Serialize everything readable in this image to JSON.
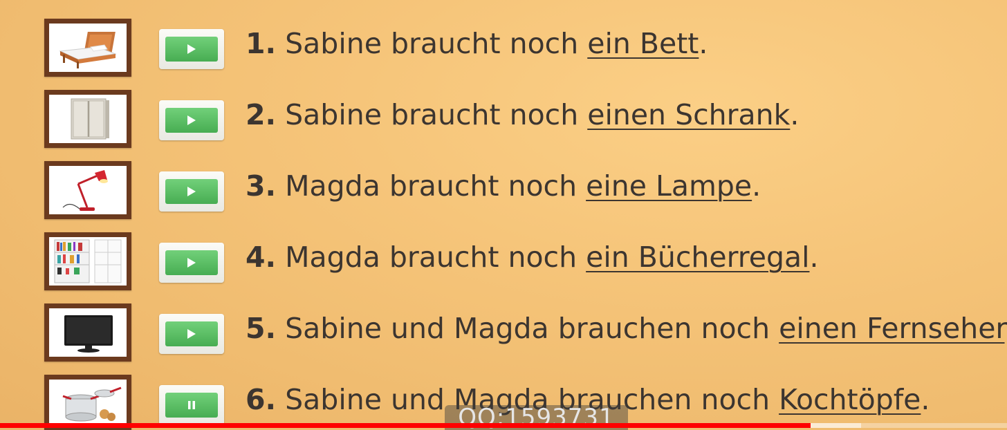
{
  "items": [
    {
      "number": "1.",
      "prefix": "Sabine braucht noch ",
      "noun": "ein Bett",
      "suffix": ".",
      "thumbnail_icon": "bed-icon",
      "button_state": "play"
    },
    {
      "number": "2.",
      "prefix": "Sabine braucht noch ",
      "noun": "einen Schrank",
      "suffix": ".",
      "thumbnail_icon": "wardrobe-icon",
      "button_state": "play"
    },
    {
      "number": "3.",
      "prefix": "Magda braucht noch ",
      "noun": "eine Lampe",
      "suffix": ".",
      "thumbnail_icon": "desk-lamp-icon",
      "button_state": "play"
    },
    {
      "number": "4.",
      "prefix": "Magda braucht noch ",
      "noun": "ein Bücherregal",
      "suffix": ".",
      "thumbnail_icon": "bookshelf-icon",
      "button_state": "play"
    },
    {
      "number": "5.",
      "prefix": "Sabine und Magda brauchen noch ",
      "noun": "einen Fernseher",
      "suffix": ".",
      "thumbnail_icon": "tv-icon",
      "button_state": "play"
    },
    {
      "number": "6.",
      "prefix": "Sabine und Magda brauchen noch ",
      "noun": "Kochtöpfe",
      "suffix": ".",
      "thumbnail_icon": "cooking-pots-icon",
      "button_state": "pause"
    }
  ],
  "watermark": "QQ:1593731",
  "video_progress": {
    "played_fraction": 0.805
  },
  "colors": {
    "background": "#f6c57a",
    "frame": "#6b3a1e",
    "button_green": "#5cbf62",
    "text": "#3c3530",
    "progress_red": "#ff0000"
  }
}
